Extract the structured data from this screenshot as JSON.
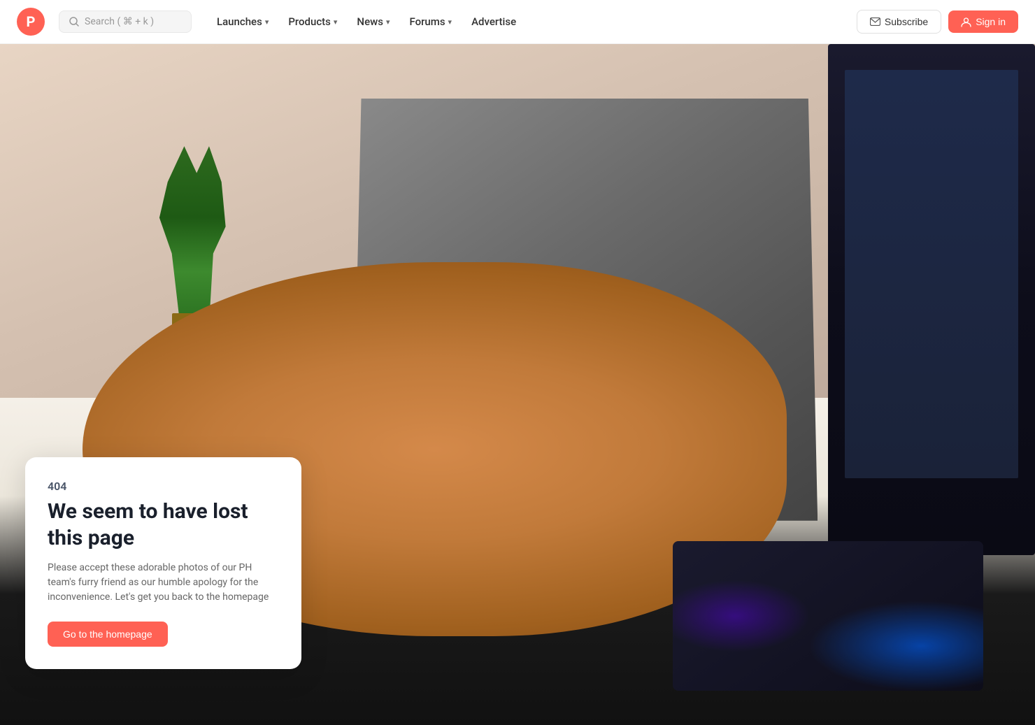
{
  "brand": {
    "logo_letter": "P",
    "logo_color": "#ff6154"
  },
  "search": {
    "placeholder": "Search ( ⌘ + k )"
  },
  "nav": {
    "items": [
      {
        "label": "Launches",
        "has_dropdown": true
      },
      {
        "label": "Products",
        "has_dropdown": true
      },
      {
        "label": "News",
        "has_dropdown": true
      },
      {
        "label": "Forums",
        "has_dropdown": true
      },
      {
        "label": "Advertise",
        "has_dropdown": false
      }
    ]
  },
  "actions": {
    "subscribe_label": "Subscribe",
    "signin_label": "Sign in"
  },
  "error_page": {
    "code": "404",
    "title": "We seem to have lost this page",
    "description": "Please accept these adorable photos of our PH team's furry friend as our humble apology for the inconvenience. Let's get you back to the homepage",
    "cta_label": "Go to the homepage"
  }
}
